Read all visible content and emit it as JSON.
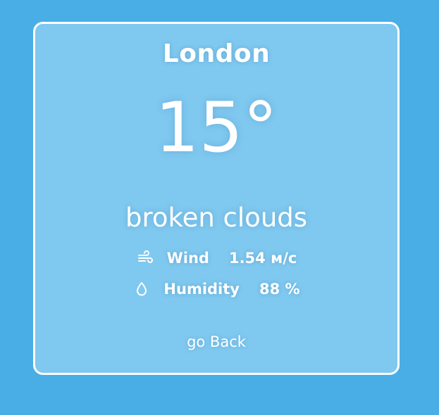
{
  "weather": {
    "city": "London",
    "temperature": "15°",
    "description": "broken clouds",
    "wind": {
      "label": "Wind",
      "value": "1.54 м/с",
      "icon": "wind-icon"
    },
    "humidity": {
      "label": "Humidity",
      "value": "88 %",
      "icon": "water-drop-icon"
    }
  },
  "navigation": {
    "back_label": "go Back"
  },
  "colors": {
    "background": "#4aaee6",
    "card": "#7fc8ef",
    "border": "#ffffff",
    "text": "#ffffff"
  }
}
